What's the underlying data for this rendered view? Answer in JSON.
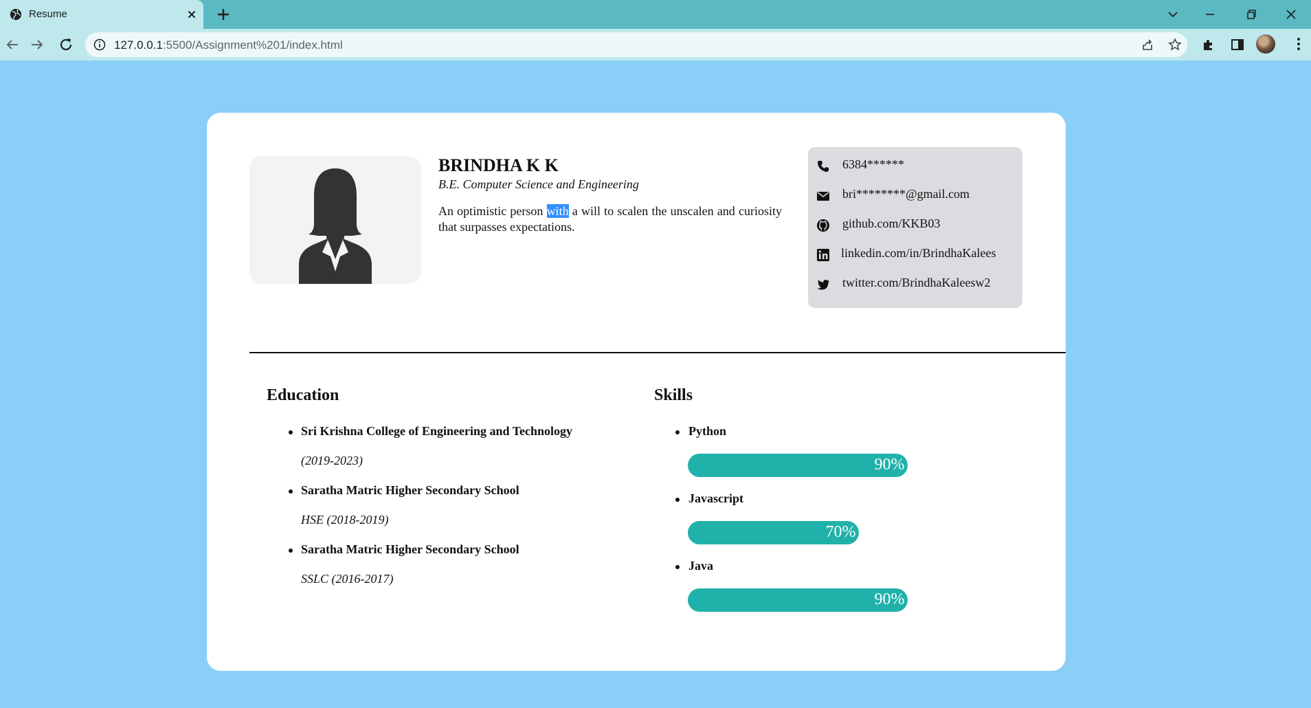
{
  "browser": {
    "tab_title": "Resume",
    "url_host": "127.0.0.1",
    "url_path": ":5500/Assignment%201/index.html"
  },
  "profile": {
    "name": "BRINDHA K K",
    "degree": "B.E. Computer Science and Engineering",
    "summary_before": "An optimistic person ",
    "summary_highlight": "with",
    "summary_after": " a will to scalen the unscalen and curiosity that surpasses expectations."
  },
  "contacts": [
    {
      "icon": "phone-icon",
      "text": "6384******"
    },
    {
      "icon": "envelope-icon",
      "text": "bri********@gmail.com"
    },
    {
      "icon": "github-icon",
      "text": "github.com/KKB03"
    },
    {
      "icon": "linkedin-icon",
      "text": "linkedin.com/in/BrindhaKalees"
    },
    {
      "icon": "twitter-icon",
      "text": "twitter.com/BrindhaKaleesw2"
    }
  ],
  "education": {
    "title": "Education",
    "items": [
      {
        "school": "Sri Krishna College of Engineering and Technology",
        "years": "(2019-2023)"
      },
      {
        "school": "Saratha Matric Higher Secondary School",
        "years": "HSE (2018-2019)"
      },
      {
        "school": "Saratha Matric Higher Secondary School",
        "years": "SSLC (2016-2017)"
      }
    ]
  },
  "skills": {
    "title": "Skills",
    "items": [
      {
        "name": "Python",
        "label": "90%",
        "percent": 90
      },
      {
        "name": "Javascript",
        "label": "70%",
        "percent": 70
      },
      {
        "name": "Java",
        "label": "90%",
        "percent": 90
      }
    ]
  },
  "colors": {
    "page_bg": "#89cff8",
    "bar": "#20b2aa",
    "contact_bg": "#dcdce0",
    "tabbar": "#5bb9c2",
    "toolbar": "#bee8ec"
  }
}
